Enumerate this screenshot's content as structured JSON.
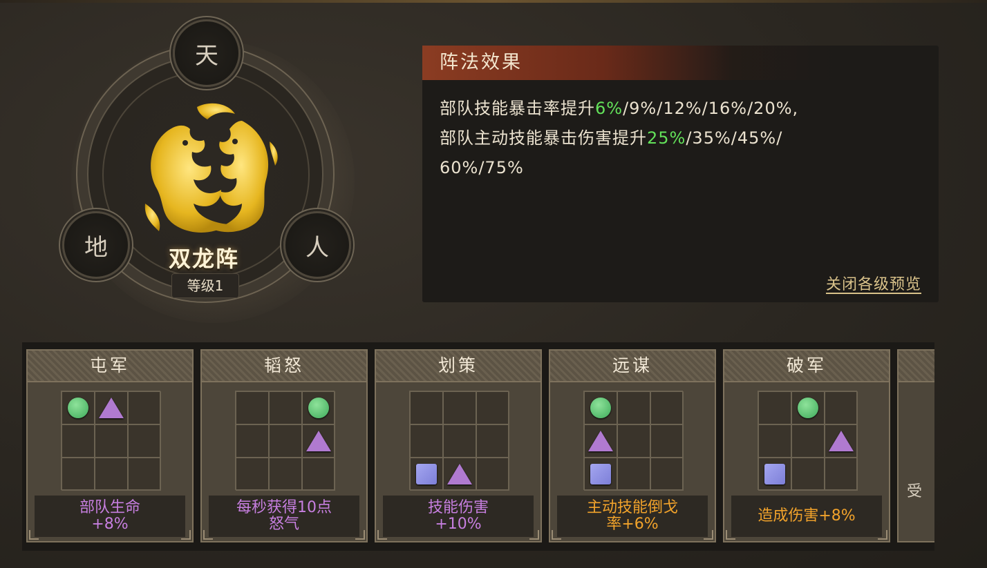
{
  "formation": {
    "name": "双龙阵",
    "level_label": "等级1",
    "seals": {
      "heaven": "天",
      "earth": "地",
      "man": "人"
    }
  },
  "effect_panel": {
    "title": "阵法效果",
    "line1_prefix": "部队技能暴击率提升",
    "line1_highlight": "6%",
    "line1_suffix": "/9%/12%/16%/20%,",
    "line2_prefix": "部队主动技能暴击伤害提升",
    "line2_highlight": "25%",
    "line2_suffix": "/35%/45%/",
    "line3": "60%/75%",
    "close_preview_label": "关闭各级预览"
  },
  "cards": [
    {
      "title": "屯军",
      "desc_line1": "部队生命",
      "desc_line2": "+8%",
      "desc_color": "purple",
      "grid": [
        "circle",
        "triangle",
        "",
        "",
        "",
        "",
        "",
        "",
        ""
      ]
    },
    {
      "title": "韬怒",
      "desc_line1": "每秒获得10点",
      "desc_line2": "怒气",
      "desc_color": "purple",
      "grid": [
        "",
        "",
        "circle",
        "",
        "",
        "triangle",
        "",
        "",
        ""
      ]
    },
    {
      "title": "划策",
      "desc_line1": "技能伤害",
      "desc_line2": "+10%",
      "desc_color": "purple",
      "grid": [
        "",
        "",
        "",
        "",
        "",
        "",
        "square",
        "triangle",
        ""
      ]
    },
    {
      "title": "远谋",
      "desc_line1": "主动技能倒戈",
      "desc_line2": "率+6%",
      "desc_color": "orange",
      "grid": [
        "circle",
        "",
        "",
        "triangle",
        "",
        "",
        "square",
        "",
        ""
      ]
    },
    {
      "title": "破军",
      "desc_line1": "造成伤害+8%",
      "desc_line2": "",
      "desc_color": "orange",
      "grid": [
        "",
        "circle",
        "",
        "",
        "",
        "triangle",
        "square",
        "",
        ""
      ]
    }
  ],
  "partial_card": {
    "text": "受"
  },
  "colors": {
    "highlight_green": "#63e15a",
    "desc_purple": "#c77fe0",
    "desc_orange": "#f2a32b",
    "header_red": "#8b3c22"
  }
}
